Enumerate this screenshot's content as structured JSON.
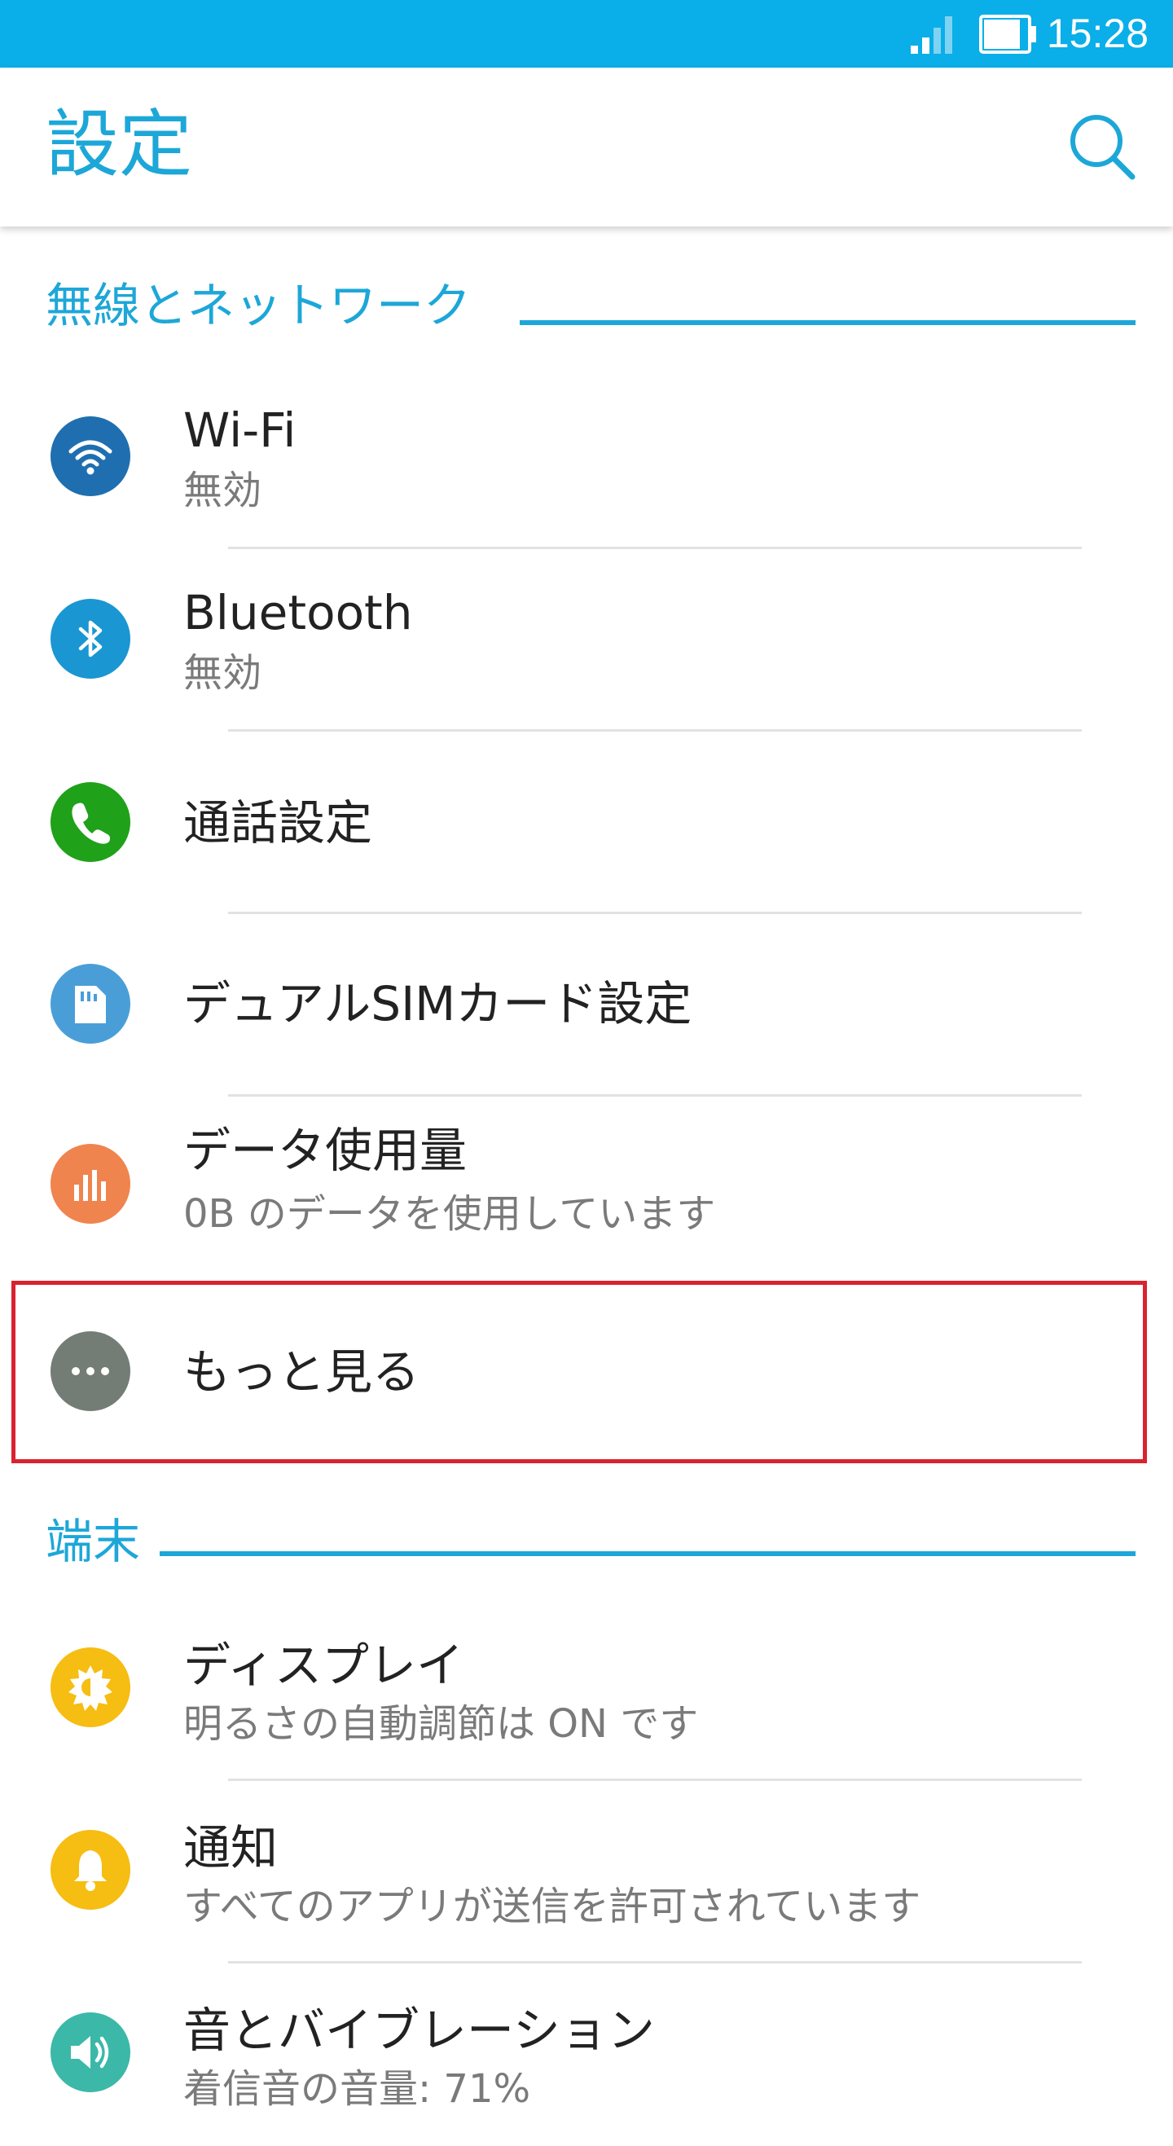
{
  "status_bar": {
    "time": "15:28",
    "color": "#0aaee8"
  },
  "app_bar": {
    "title": "設定",
    "search_icon": "search-icon"
  },
  "sections": [
    {
      "title": "無線とネットワーク",
      "items": [
        {
          "title": "Wi-Fi",
          "subtitle": "無効",
          "icon": "wifi-icon",
          "color": "#1f6fb0"
        },
        {
          "title": "Bluetooth",
          "subtitle": "無効",
          "icon": "bluetooth-icon",
          "color": "#1a96d2"
        },
        {
          "title": "通話設定",
          "icon": "phone-icon",
          "color": "#1fa11a"
        },
        {
          "title": "デュアルSIMカード設定",
          "icon": "sim-card-icon",
          "color": "#4a9ed8"
        },
        {
          "title": "データ使用量",
          "subtitle": "0B のデータを使用しています",
          "icon": "data-usage-icon",
          "color": "#f0844e"
        },
        {
          "title": "もっと見る",
          "icon": "more-icon",
          "color": "#737d75"
        }
      ]
    },
    {
      "title": "端末",
      "items": [
        {
          "title": "ディスプレイ",
          "subtitle": "明るさの自動調節は ON です",
          "icon": "brightness-icon",
          "color": "#f6bd12"
        },
        {
          "title": "通知",
          "subtitle": "すべてのアプリが送信を許可されています",
          "icon": "bell-icon",
          "color": "#f6bd12"
        },
        {
          "title": "音とバイブレーション",
          "subtitle": "着信音の音量: 71%",
          "icon": "speaker-icon",
          "color": "#3bb8a8"
        }
      ]
    }
  ]
}
